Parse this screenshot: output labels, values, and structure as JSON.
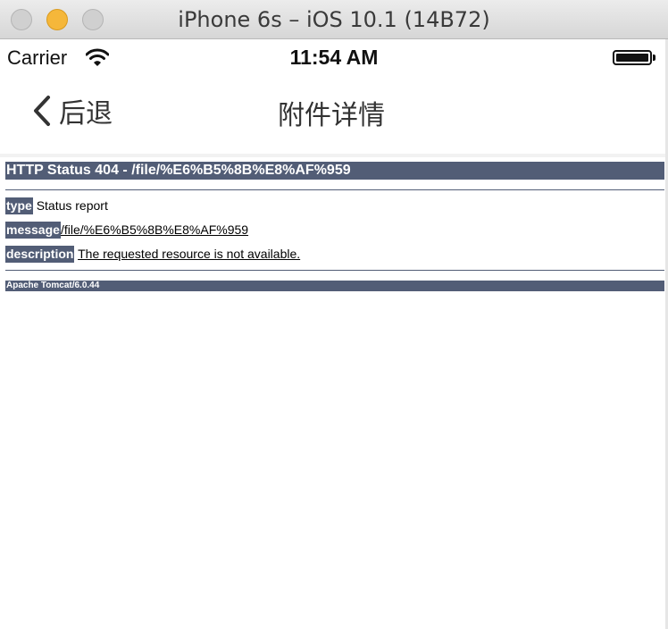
{
  "window": {
    "title": "iPhone 6s – iOS 10.1 (14B72)"
  },
  "status_bar": {
    "carrier": "Carrier",
    "time": "11:54 AM",
    "icons": [
      "wifi-icon",
      "battery-icon"
    ]
  },
  "nav_bar": {
    "back_label": "后退",
    "title": "附件详情"
  },
  "error_page": {
    "heading": "HTTP Status 404 - /file/%E6%B5%8B%E8%AF%959",
    "rows": [
      {
        "label": "type",
        "value": "Status report"
      },
      {
        "label": "message",
        "value": "/file/%E6%B5%8B%E8%AF%959"
      },
      {
        "label": "description",
        "value": "The requested resource is not available."
      }
    ],
    "footer": "Apache Tomcat/6.0.44"
  },
  "colors": {
    "tomcat_header": "#525d76",
    "minimize_button": "#f5b73a"
  }
}
